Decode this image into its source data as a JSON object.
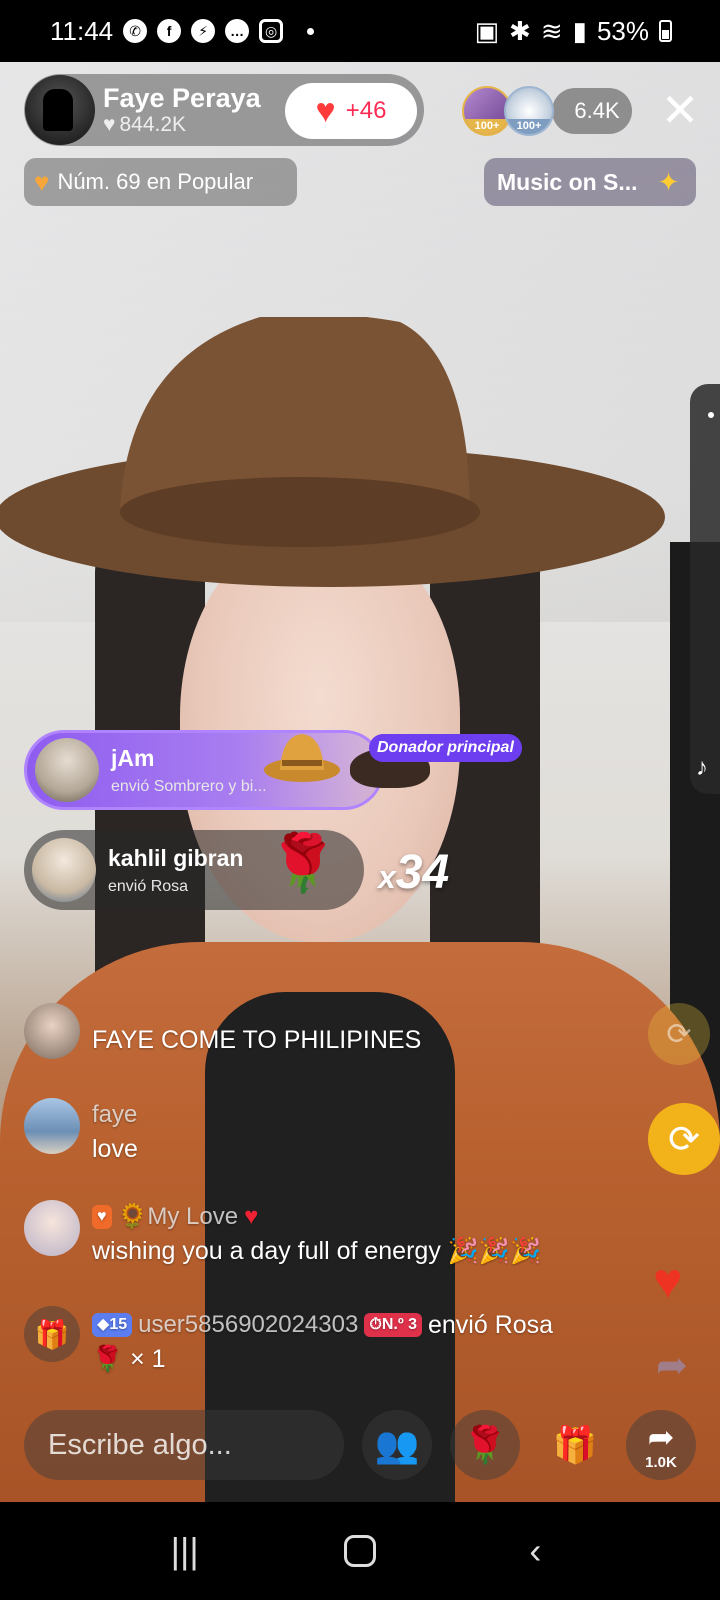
{
  "status_bar": {
    "time": "11:44",
    "battery": "53%"
  },
  "host": {
    "name": "Faye Peraya",
    "likes": "844.2K",
    "like_delta": "+46"
  },
  "viewers": {
    "badge1": "100+",
    "badge2": "100+",
    "count": "6.4K"
  },
  "rank": {
    "label": "Núm. 69 en Popular"
  },
  "music": {
    "label": "Music on S..."
  },
  "gifts": [
    {
      "user": "jAm",
      "desc": "envió Sombrero y bi...",
      "tag": "Donador principal"
    },
    {
      "user": "kahlil gibran",
      "desc": "envió Rosa",
      "combo_x": "x",
      "combo_n": "34"
    }
  ],
  "comments": [
    {
      "name": "",
      "text": "FAYE COME TO PHILIPINES"
    },
    {
      "name": "faye",
      "text": "love"
    },
    {
      "name": "🌻My Love",
      "text": "wishing you a day full of energy 🎉🎉🎉"
    },
    {
      "badge_level": "15",
      "name": "user5856902024303",
      "badge_rank": "N.º 3",
      "action": "envió Rosa",
      "qty": "🌹 × 1"
    }
  ],
  "bottom_bar": {
    "input_placeholder": "Escribe algo...",
    "share_count": "1.0K"
  },
  "colors": {
    "accent": "#fe2c55",
    "gift_purple": "#8e5cf0",
    "repost_yellow": "#f2b31a"
  }
}
